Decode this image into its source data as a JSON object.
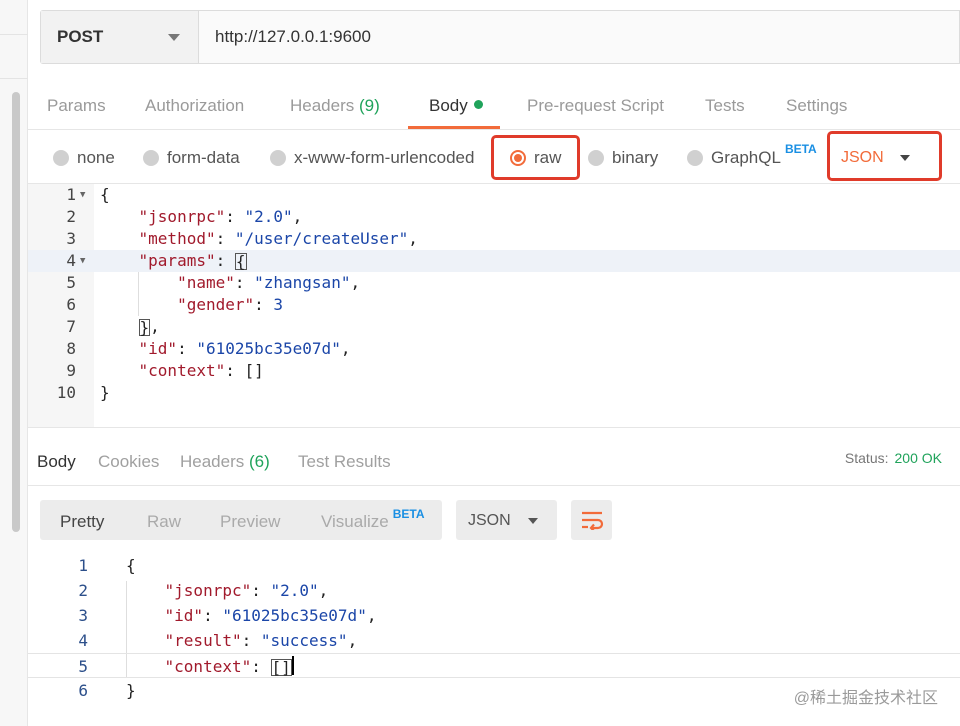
{
  "request": {
    "method": "POST",
    "url": "http://127.0.0.1:9600"
  },
  "request_tabs": [
    {
      "label": "Params"
    },
    {
      "label": "Authorization"
    },
    {
      "label": "Headers",
      "count": "(9)"
    },
    {
      "label": "Body"
    },
    {
      "label": "Pre-request Script"
    },
    {
      "label": "Tests"
    },
    {
      "label": "Settings"
    }
  ],
  "body_types": {
    "none": "none",
    "form_data": "form-data",
    "urlencoded": "x-www-form-urlencoded",
    "raw": "raw",
    "binary": "binary",
    "graphql": "GraphQL",
    "beta": "BETA",
    "format": "JSON"
  },
  "request_body": {
    "line_numbers": [
      "1",
      "2",
      "3",
      "4",
      "5",
      "6",
      "7",
      "8",
      "9",
      "10"
    ],
    "open_brace": "{",
    "jsonrpc_key": "\"jsonrpc\"",
    "jsonrpc_val": "\"2.0\"",
    "method_key": "\"method\"",
    "method_val": "\"/user/createUser\"",
    "params_key": "\"params\"",
    "name_key": "\"name\"",
    "name_val": "\"zhangsan\"",
    "gender_key": "\"gender\"",
    "gender_val": "3",
    "id_key": "\"id\"",
    "id_val": "\"61025bc35e07d\"",
    "context_key": "\"context\"",
    "context_val": "[]",
    "close_brace": "}"
  },
  "response_tabs": [
    {
      "label": "Body"
    },
    {
      "label": "Cookies"
    },
    {
      "label": "Headers",
      "count": "(6)"
    },
    {
      "label": "Test Results"
    }
  ],
  "status": {
    "label": "Status:",
    "value": "200 OK"
  },
  "view_options": {
    "pretty": "Pretty",
    "raw": "Raw",
    "preview": "Preview",
    "visualize": "Visualize",
    "beta": "BETA",
    "format": "JSON"
  },
  "response_body": {
    "line_numbers": [
      "1",
      "2",
      "3",
      "4",
      "5",
      "6"
    ],
    "open_brace": "{",
    "jsonrpc_key": "\"jsonrpc\"",
    "jsonrpc_val": "\"2.0\"",
    "id_key": "\"id\"",
    "id_val": "\"61025bc35e07d\"",
    "result_key": "\"result\"",
    "result_val": "\"success\"",
    "context_key": "\"context\"",
    "context_val": "[]",
    "close_brace": "}"
  },
  "watermark": "@稀土掘金技术社区",
  "colors": {
    "accent": "#f26b3a",
    "success": "#20a35b",
    "highlight_box": "#e03b2a",
    "json_key": "#a11a2c",
    "json_value": "#1b46a8"
  }
}
